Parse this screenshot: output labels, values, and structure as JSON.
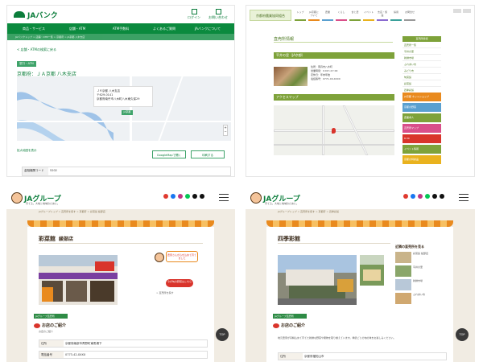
{
  "panel_a": {
    "logo": "JAバンク",
    "header_icons": [
      {
        "label": "ログイン"
      },
      {
        "label": "お問い合わせ"
      }
    ],
    "nav": [
      "商品・サービス",
      "店舗・ATM",
      "ATM手数料",
      "よくあるご質問",
      "JAバンクについて"
    ],
    "breadcrumb": "JAバンクトップ > 店舗・ATM一覧 > 京都府 > JA京都 八木支店",
    "back_link": "< 店舗・ATMの検索に戻る",
    "tag": "窓口・ATM",
    "branch_title": "京都府：ＪＡ京都 八木支店",
    "map_info": [
      "ＪＡ京都 八木支店",
      "〒629-0141",
      "京都府南丹市八木町八木東久保29"
    ],
    "map_pin": "JA京都",
    "map_link": "拡大地図を表示",
    "buttons": [
      "GoogleMapで開く",
      "印刷する"
    ],
    "table": {
      "header": "金融機関コード",
      "value": "5202"
    }
  },
  "panel_b": {
    "logo": "京都府農業協同組合",
    "nav": [
      "トップ",
      "JA京都について",
      "農業",
      "くらし",
      "食と農",
      "イベント",
      "支店・施設",
      "採用",
      "お問合せ"
    ],
    "nav_colors": [
      "#7ea23a",
      "#e98a1e",
      "#5aa0d0",
      "#d94f8a",
      "#7ea23a",
      "#e9b21e",
      "#8a6ad0",
      "#3aa09a",
      "#999999"
    ],
    "page_title": "直売所情報",
    "section1": "平井の里（JA京都）",
    "info_lines": [
      "住所：南丹市八木町",
      "営業時間：9:00〜17:00",
      "定休日：年末年始",
      "電話番号：0771-XX-XXXX"
    ],
    "section2": "アクセスマップ",
    "sidebar_title": "直売所情報",
    "sidebar_items": [
      "直売所一覧",
      "平井の里",
      "新鮮市場",
      "ふれあい市",
      "みどり市",
      "旬菜館",
      "彩菜館",
      "四季彩館",
      "その他"
    ],
    "banners": [
      {
        "label": "JA京都 ネットショップ",
        "color": "#e98a1e"
      },
      {
        "label": "京都の野菜",
        "color": "#5aa0d0"
      },
      {
        "label": "農業求人",
        "color": "#7ea23a"
      },
      {
        "label": "直売所マップ",
        "color": "#d94f8a"
      },
      {
        "label": "8.30",
        "color": "#d9342b"
      },
      {
        "label": "イベント情報",
        "color": "#7ea23a"
      },
      {
        "label": "京都の特産品",
        "color": "#e9b21e"
      }
    ]
  },
  "panel_c": {
    "logo": "JAグループ",
    "tagline": "育てる。大地と地域のために。",
    "breadcrumb": "JAグループトップ > 直売所を探す > 京都府 > 彩菜館 綾部店",
    "store_name": "彩菜館",
    "store_branch": "綾部店",
    "bubble": "農家さんが心を込めて育てました",
    "pill": "今が旬の野菜はこちら",
    "side_link": "> 直売所を探す",
    "badge": "JAグループ直売所",
    "intro": "お店のご紹介",
    "sublink": "お店のご紹介",
    "table": [
      {
        "header": "住所",
        "value": "京都府綾部市青野町東馬場下"
      },
      {
        "header": "電話番号",
        "value": "0773-42-XXXX"
      }
    ],
    "top_button": "TOP"
  },
  "panel_d": {
    "logo": "JAグループ",
    "tagline": "育てる。大地と地域のために。",
    "breadcrumb": "JAグループトップ > 直売所を探す > 京都府 > 四季彩館",
    "store_name": "四季彩館",
    "side_heading": "近隣の直売所を見る",
    "side_items": [
      "彩菜館 綾部店",
      "平井の里",
      "新鮮市場",
      "ふれあい市"
    ],
    "badge": "JAグループ直売所",
    "intro": "お店のご紹介",
    "body": "地元農家が丹精込めて育てた新鮮な野菜や果物を取り揃えています。季節ごとの旬の味をお楽しみください。",
    "table": [
      {
        "header": "住所",
        "value": "京都府福知山市"
      }
    ],
    "top_button": "TOP"
  }
}
